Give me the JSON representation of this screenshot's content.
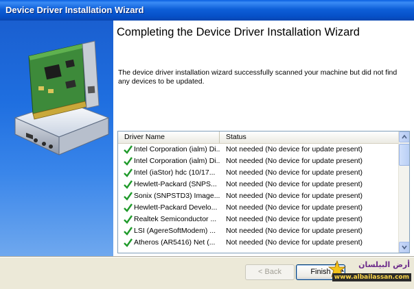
{
  "window": {
    "title": "Device Driver Installation Wizard"
  },
  "page": {
    "heading": "Completing the Device Driver Installation Wizard",
    "description": "The device driver installation wizard successfully scanned your machine but did not find any devices to be updated."
  },
  "list": {
    "columns": [
      "Driver Name",
      "Status"
    ],
    "rows": [
      {
        "name": "Intel Corporation (ialm) Di...",
        "status": "Not needed (No device for update present)"
      },
      {
        "name": "Intel Corporation (ialm) Di...",
        "status": "Not needed (No device for update present)"
      },
      {
        "name": "Intel (iaStor) hdc  (10/17...",
        "status": "Not needed (No device for update present)"
      },
      {
        "name": "Hewlett-Packard (SNPS...",
        "status": "Not needed (No device for update present)"
      },
      {
        "name": "Sonix (SNPSTD3) Image...",
        "status": "Not needed (No device for update present)"
      },
      {
        "name": "Hewlett-Packard Develo...",
        "status": "Not needed (No device for update present)"
      },
      {
        "name": "Realtek Semiconductor ...",
        "status": "Not needed (No device for update present)"
      },
      {
        "name": "LSI (AgereSoftModem) ...",
        "status": "Not needed (No device for update present)"
      },
      {
        "name": "Atheros (AR5416) Net  (...",
        "status": "Not needed (No device for update present)"
      }
    ]
  },
  "buttons": {
    "back": "< Back",
    "finish": "Finish"
  },
  "watermark": {
    "line1": "أرض البيلسان",
    "line2": "www.albailassan.com"
  },
  "colors": {
    "titlebar": "#0a5fe0",
    "check": "#1f9a2a",
    "panel": "#1f6fe0"
  },
  "icons": {
    "row_status": "checkmark-icon",
    "hero": "network-card-icon"
  }
}
